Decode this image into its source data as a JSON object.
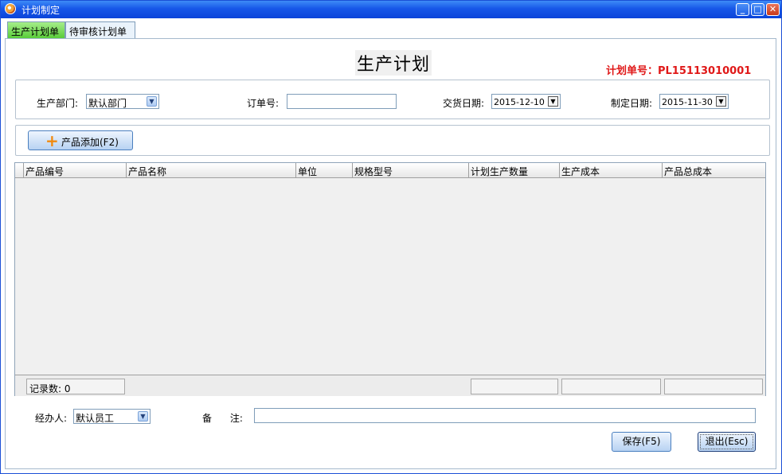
{
  "window": {
    "title": "计划制定"
  },
  "tabs": [
    {
      "label": "生产计划单"
    },
    {
      "label": "待审核计划单"
    }
  ],
  "page": {
    "title": "生产计划",
    "plan_number": "计划单号：PL15113010001"
  },
  "form": {
    "department_label": "生产部门:",
    "department_value": "默认部门",
    "order_no_label": "订单号:",
    "order_no_value": "",
    "delivery_date_label": "交货日期:",
    "delivery_date_value": "2015-12-10",
    "plan_date_label": "制定日期:",
    "plan_date_value": "2015-11-30"
  },
  "toolbar": {
    "add_product_label": "产品添加(F2)"
  },
  "table": {
    "columns": [
      "产品编号",
      "产品名称",
      "单位",
      "规格型号",
      "计划生产数量",
      "生产成本",
      "产品总成本"
    ],
    "rows": [],
    "record_count": "记录数: 0"
  },
  "footer": {
    "handler_label": "经办人:",
    "handler_value": "默认员工",
    "remark_label": "备      注:",
    "remark_value": "",
    "save_label": "保存(F5)",
    "exit_label": "退出(Esc)"
  },
  "colors": {
    "titlebar": "#1757e8",
    "active_tab": "#59cc3a",
    "plan_number": "#e01818"
  }
}
